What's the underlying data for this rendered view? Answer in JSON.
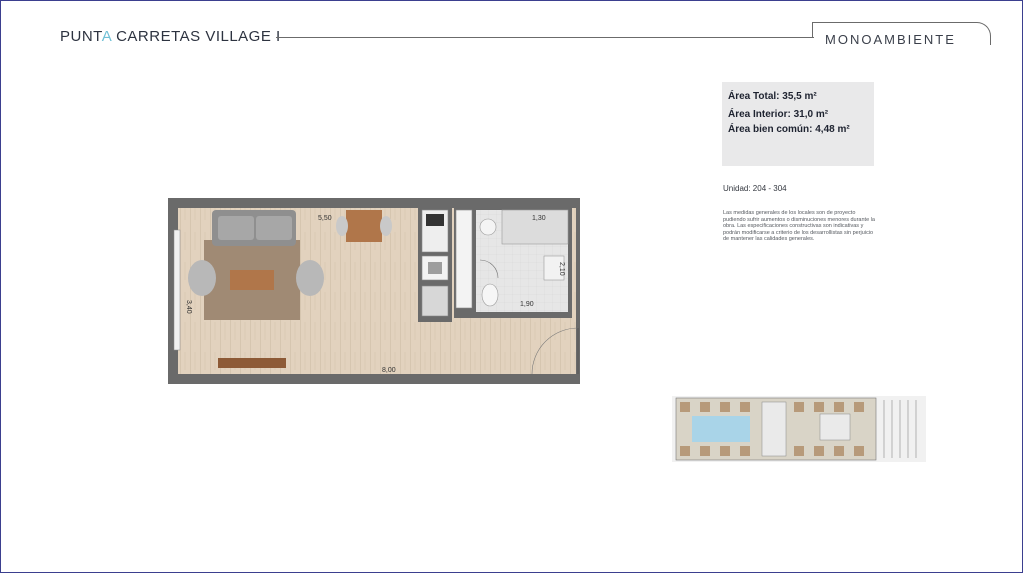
{
  "header": {
    "brand_prefix": "PUNT",
    "brand_accent": "A",
    "brand_suffix": " CARRETAS VILLAGE I",
    "unit_type": "MONOAMBIENTE"
  },
  "areas": {
    "total": "Área Total: 35,5 m²",
    "interior": "Área Interior: 31,0 m²",
    "common": "Área bien común: 4,48 m²"
  },
  "unit_label": "Unidad: 204 - 304",
  "disclaimer": "Las medidas generales de los locales son de proyecto pudiendo sufrir aumentos o disminuciones menores durante la obra. Las especificaciones constructivas son indicativas y podrán modificarse a criterio de los desarrollistas sin perjuicio de mantener las calidades generales.",
  "dimensions": {
    "living_width": "5,50",
    "total_length": "8,00",
    "height_left": "3,40",
    "bath_top": "1,30",
    "bath_side": "2,10",
    "bath_bottom": "1,90"
  },
  "colors": {
    "brand_accent": "#6fc0d6",
    "wall": "#6a6a6a",
    "wood_floor": "#e2d2be",
    "tile_floor": "#e4e4e4",
    "rug": "#a08a74",
    "pool": "#a9d4e8"
  }
}
